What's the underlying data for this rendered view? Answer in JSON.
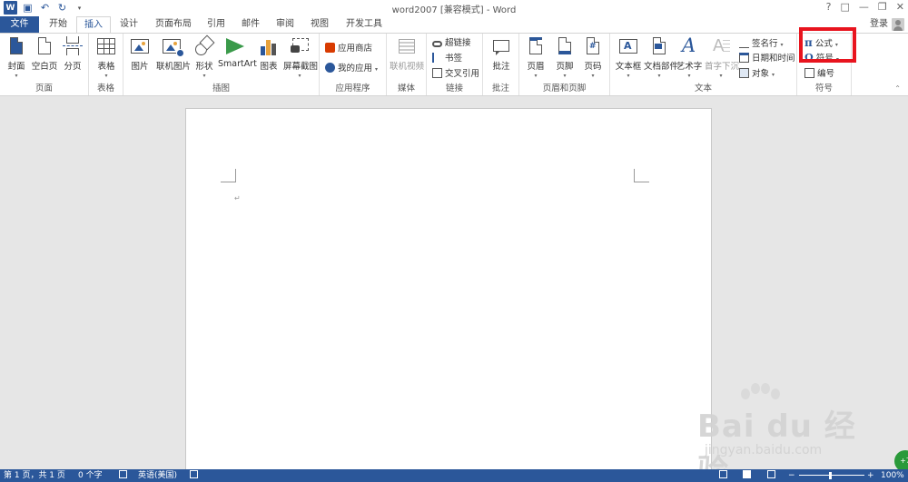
{
  "window": {
    "title": "word2007 [兼容模式] - Word",
    "signin": "登录"
  },
  "qat": {
    "app_icon": "word-icon",
    "save_icon": "save-icon",
    "undo_icon": "undo-icon",
    "redo_icon": "redo-icon",
    "customize_icon": "customize-qat-icon"
  },
  "tabs": [
    "文件",
    "开始",
    "插入",
    "设计",
    "页面布局",
    "引用",
    "邮件",
    "审阅",
    "视图",
    "开发工具"
  ],
  "active_tab": "插入",
  "ribbon": {
    "pages": {
      "label": "页面",
      "cover": "封面",
      "blank": "空白页",
      "break": "分页"
    },
    "tables": {
      "label": "表格",
      "table": "表格"
    },
    "illustrations": {
      "label": "插图",
      "picture": "图片",
      "online_picture": "联机图片",
      "shapes": "形状",
      "smartart": "SmartArt",
      "chart": "图表",
      "screenshot": "屏幕截图"
    },
    "apps": {
      "label": "应用程序",
      "store": "应用商店",
      "my_apps": "我的应用"
    },
    "media": {
      "label": "媒体",
      "online_video": "联机视频"
    },
    "links": {
      "label": "链接",
      "hyperlink": "超链接",
      "bookmark": "书签",
      "cross_ref": "交叉引用"
    },
    "comments": {
      "label": "批注",
      "comment": "批注"
    },
    "header_footer": {
      "label": "页眉和页脚",
      "header": "页眉",
      "footer": "页脚",
      "page_number": "页码"
    },
    "text": {
      "label": "文本",
      "textbox": "文本框",
      "quick_parts": "文档部件",
      "wordart": "艺术字",
      "dropcap": "首字下沉",
      "signature": "签名行",
      "datetime": "日期和时间",
      "object": "对象"
    },
    "symbols": {
      "label": "符号",
      "equation": "公式",
      "symbol": "符号",
      "numbering": "编号"
    }
  },
  "document": {
    "paragraph_mark": "↵"
  },
  "status": {
    "page": "第 1 页，共 1 页",
    "words": "0 个字",
    "language": "英语(美国)",
    "zoom": "100%"
  },
  "watermark": {
    "brand": "Bai du 经验",
    "url": "jingyan.baidu.com",
    "badge": "+7"
  },
  "colors": {
    "accent": "#2b579a",
    "highlight": "#e8141e"
  }
}
